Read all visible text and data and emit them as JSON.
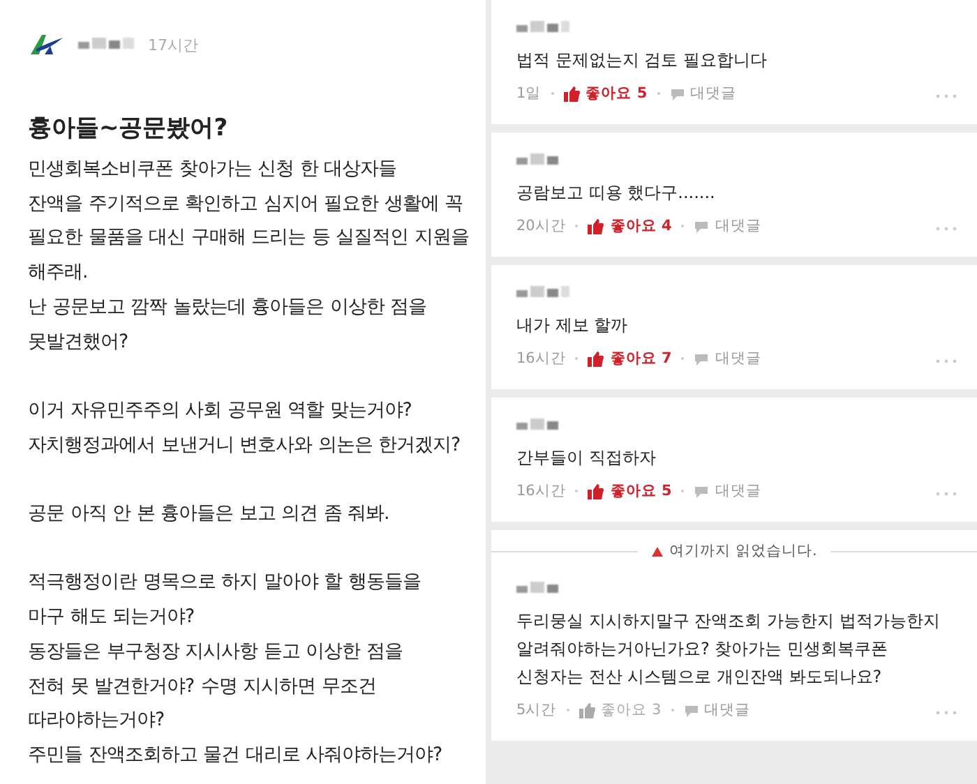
{
  "post": {
    "author_time": "17시간",
    "title": "흉아들~공문봤어?",
    "paragraphs": [
      [
        "민생회복소비쿠폰 찾아가는 신청 한 대상자들",
        "잔액을 주기적으로 확인하고 심지어 필요한 생활에 꼭",
        "필요한 물품을 대신 구매해 드리는 등 실질적인 지원을",
        "해주래.",
        "난 공문보고 깜짝 놀랐는데 흉아들은 이상한 점을",
        "못발견했어?"
      ],
      [
        "이거 자유민주주의 사회 공무원 역할 맞는거야?",
        "자치행정과에서 보낸거니 변호사와 의논은 한거겠지?"
      ],
      [
        "공문 아직 안 본 흉아들은  보고 의견 좀 줘봐."
      ],
      [
        "적극행정이란 명목으로 하지 말아야 할 행동들을",
        "마구 해도 되는거야?",
        "동장들은 부구청장 지시사항 듣고 이상한 점을",
        "전혀 못 발견한거야? 수명 지시하면 무조건",
        "따라야하는거야?",
        "주민들 잔액조회하고 물건 대리로 사줘야하는거야?"
      ]
    ]
  },
  "comments": [
    {
      "text": "법적 문제없는지 검토 필요합니다",
      "time": "1일",
      "like_label": "좋아요 5",
      "liked": true,
      "reply_label": "대댓글"
    },
    {
      "text": "공람보고 띠용 했다구.......",
      "time": "20시간",
      "like_label": "좋아요 4",
      "liked": true,
      "reply_label": "대댓글"
    },
    {
      "text": "내가 제보 할까",
      "time": "16시간",
      "like_label": "좋아요 7",
      "liked": true,
      "reply_label": "대댓글"
    },
    {
      "text": "간부들이 직접하자",
      "time": "16시간",
      "like_label": "좋아요 5",
      "liked": true,
      "reply_label": "대댓글"
    },
    {
      "kind": "divider",
      "text": "여기까지 읽었습니다."
    },
    {
      "text": "두리뭉실 지시하지말구 잔액조회  가능한지 법적가능한지 알려줘야하는거아닌가요?  찾아가는 민생회복쿠폰 신청자는  전산 시스템으로 개인잔액   봐도되나요?",
      "time": "5시간",
      "like_label": "좋아요 3",
      "liked": false,
      "reply_label": "대댓글"
    }
  ]
}
